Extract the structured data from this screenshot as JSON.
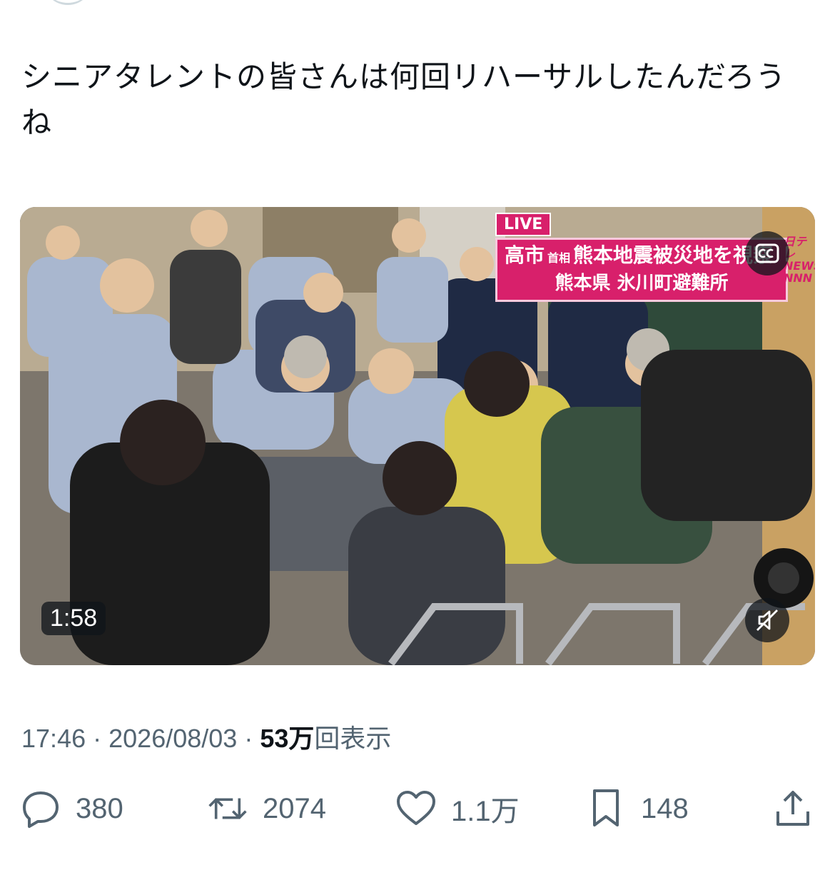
{
  "tweet": {
    "text": "シニアタレントの皆さんは何回リハーサルしたんだろうね"
  },
  "video": {
    "live_label": "LIVE",
    "banner": {
      "name": "高市",
      "title": "首相",
      "headline": "熊本地震被災地を視察",
      "location": "熊本県 氷川町避難所"
    },
    "channel_logo_top": "日テレ",
    "channel_logo_mid": "NEWS",
    "channel_logo_bottom": "NNN",
    "duration": "1:58",
    "cc_icon": "closed-captions-icon",
    "mute_icon": "muted-speaker-icon"
  },
  "meta": {
    "time": "17:46",
    "separator": "·",
    "date": "2026/08/03",
    "views_number": "53",
    "views_unit": "万",
    "views_label": "回表示"
  },
  "actions": {
    "replies": "380",
    "retweets": "2074",
    "likes": "1.1万",
    "bookmarks": "148"
  },
  "colors": {
    "text": "#0f1419",
    "muted": "#536471",
    "banner_pink": "#d8206b"
  }
}
